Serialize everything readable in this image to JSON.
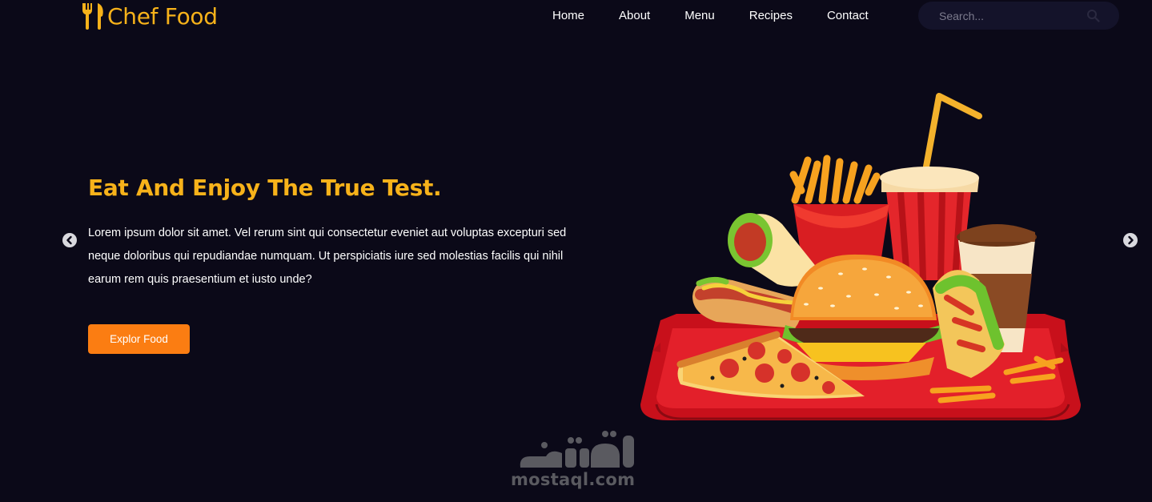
{
  "brand": {
    "name": "Chef Food",
    "logo_icon": "fork-knife-icon",
    "color": "#f7b21a"
  },
  "nav": {
    "items": [
      "Home",
      "About",
      "Menu",
      "Recipes",
      "Contact"
    ]
  },
  "search": {
    "placeholder": "Search...",
    "icon": "search-icon"
  },
  "hero": {
    "title": "Eat And Enjoy The True Test.",
    "text": "Lorem ipsum dolor sit amet. Vel rerum sint qui consectetur eveniet aut voluptas excepturi sed neque doloribus qui repudiandae numquam. Ut perspiciatis iure sed molestias facilis qui nihil earum rem quis praesentium et iusto unde?",
    "cta_label": "Explor Food",
    "cta_color": "#fb7d12"
  },
  "carousel": {
    "prev_icon": "chevron-left-icon",
    "next_icon": "chevron-right-icon"
  },
  "watermark": {
    "latin": "mostaql.com",
    "arabic": "مستقل"
  },
  "colors": {
    "background": "#0b0918",
    "accent": "#f7b21a",
    "button": "#fb7d12"
  }
}
